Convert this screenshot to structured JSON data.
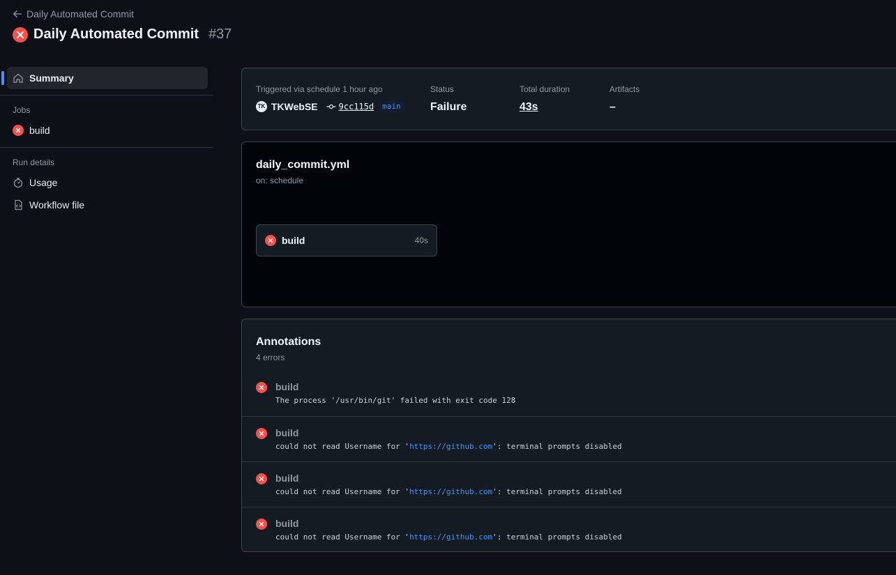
{
  "header": {
    "back_label": "Daily Automated Commit",
    "title": "Daily Automated Commit",
    "run_number": "#37"
  },
  "sidebar": {
    "summary_label": "Summary",
    "jobs_heading": "Jobs",
    "jobs": [
      {
        "label": "build"
      }
    ],
    "run_details_heading": "Run details",
    "usage_label": "Usage",
    "workflow_file_label": "Workflow file"
  },
  "summary": {
    "trigger_label": "Triggered via schedule 1 hour ago",
    "avatar_text": "TK",
    "actor": "TKWebSE",
    "commit": "9cc115d",
    "branch": "main",
    "status_label": "Status",
    "status_value": "Failure",
    "duration_label": "Total duration",
    "duration_value": "43s",
    "artifacts_label": "Artifacts",
    "artifacts_value": "–"
  },
  "workflow": {
    "file": "daily_commit.yml",
    "trigger": "on: schedule",
    "job": {
      "name": "build",
      "duration": "40s"
    }
  },
  "annotations": {
    "title": "Annotations",
    "count": "4 errors",
    "items": [
      {
        "job": "build",
        "pre": "The process '/usr/bin/git' failed with exit code 128",
        "url": "",
        "post": ""
      },
      {
        "job": "build",
        "pre": "could not read Username for '",
        "url": "https://github.com",
        "post": "': terminal prompts disabled"
      },
      {
        "job": "build",
        "pre": "could not read Username for '",
        "url": "https://github.com",
        "post": "': terminal prompts disabled"
      },
      {
        "job": "build",
        "pre": "could not read Username for '",
        "url": "https://github.com",
        "post": "': terminal prompts disabled"
      }
    ]
  },
  "colors": {
    "background": "#0d1117",
    "error": "#f85149",
    "accent": "#4493f8"
  }
}
